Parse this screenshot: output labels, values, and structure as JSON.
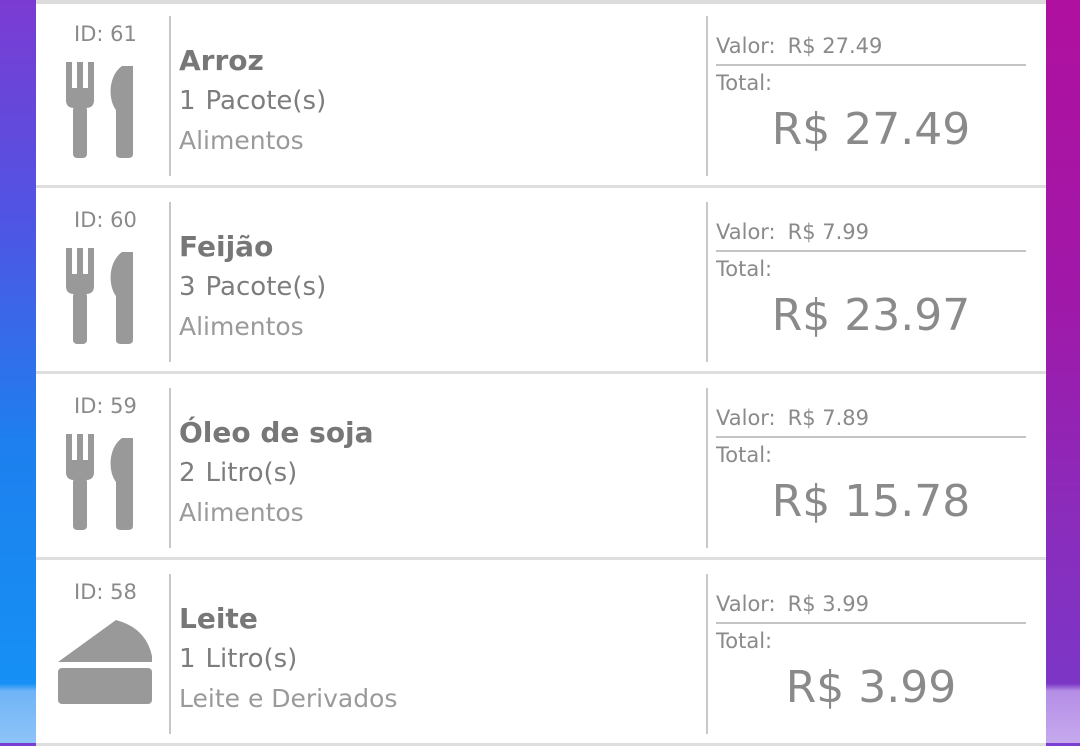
{
  "labels": {
    "valor": "Valor:",
    "total": "Total:"
  },
  "items": [
    {
      "id": "ID: 61",
      "name": "Arroz",
      "qty": "1",
      "unit": "Pacote(s)",
      "category": "Alimentos",
      "unit_price": "R$ 27.49",
      "total": "R$ 27.49",
      "icon": "fork-knife-icon"
    },
    {
      "id": "ID: 60",
      "name": "Feijão",
      "qty": "3",
      "unit": "Pacote(s)",
      "category": "Alimentos",
      "unit_price": "R$ 7.99",
      "total": "R$ 23.97",
      "icon": "fork-knife-icon"
    },
    {
      "id": "ID: 59",
      "name": "Óleo de soja",
      "qty": "2",
      "unit": "Litro(s)",
      "category": "Alimentos",
      "unit_price": "R$ 7.89",
      "total": "R$ 15.78",
      "icon": "fork-knife-icon"
    },
    {
      "id": "ID: 58",
      "name": "Leite",
      "qty": "1",
      "unit": "Litro(s)",
      "category": "Leite e Derivados",
      "unit_price": "R$ 3.99",
      "total": "R$ 3.99",
      "icon": "cheese-icon"
    }
  ]
}
